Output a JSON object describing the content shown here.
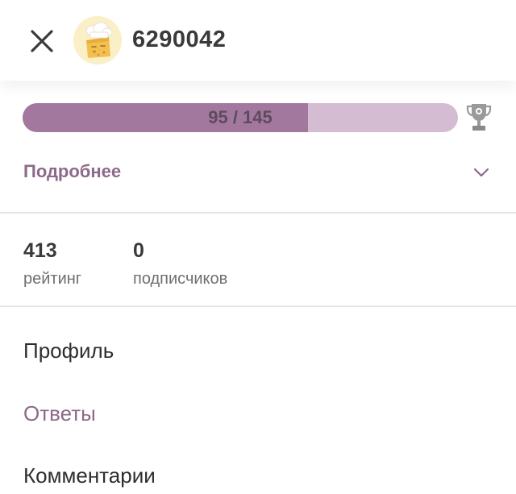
{
  "header": {
    "username": "6290042"
  },
  "progress": {
    "current": 95,
    "total": 145,
    "text": "95 / 145",
    "fill_color": "#a3789f",
    "track_color": "#d4bcd2"
  },
  "details": {
    "label": "Подробнее"
  },
  "stats": [
    {
      "value": "413",
      "label": "рейтинг"
    },
    {
      "value": "0",
      "label": "подписчиков"
    }
  ],
  "menu": [
    {
      "label": "Профиль",
      "active": false
    },
    {
      "label": "Ответы",
      "active": true
    },
    {
      "label": "Комментарии",
      "active": false
    }
  ],
  "icons": {
    "close": "close-icon",
    "avatar": "chef-cheese-avatar",
    "trophy": "trophy-icon",
    "chevron": "chevron-down-icon"
  },
  "colors": {
    "accent": "#8c6a89"
  }
}
